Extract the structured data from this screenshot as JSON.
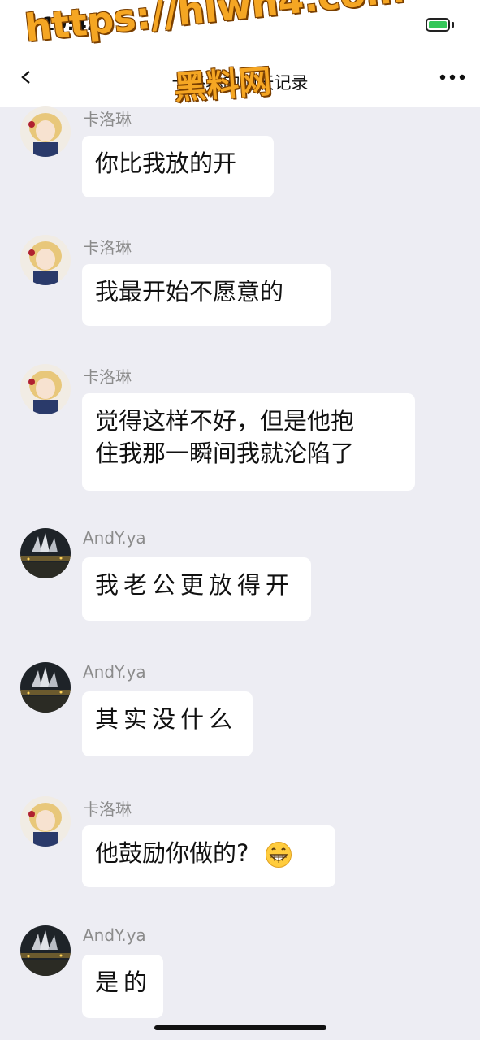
{
  "status_bar": {
    "time": "19:42",
    "battery_icon": "battery-charging-icon"
  },
  "nav_bar": {
    "title": "卡洛琳的聊天记录",
    "back_icon": "chevron-left-icon",
    "more_icon": "more-dots-icon"
  },
  "watermark": {
    "url": "https://hlwn4.com",
    "site": "黑料网"
  },
  "messages": [
    {
      "sender": "卡洛琳",
      "text": "你比我放的开"
    },
    {
      "sender": "卡洛琳",
      "text": "我最开始不愿意的"
    },
    {
      "sender": "卡洛琳",
      "line1": "觉得这样不好，但是他抱",
      "line2": "住我那一瞬间我就沦陷了"
    },
    {
      "sender": "AndY.ya",
      "text": "我老公更放得开"
    },
    {
      "sender": "AndY.ya",
      "text": "其实没什么"
    },
    {
      "sender": "卡洛琳",
      "text": "他鼓励你做的?",
      "emoji_icon": "grinning-emoji-icon"
    },
    {
      "sender": "AndY.ya",
      "text": "是的"
    }
  ],
  "colors": {
    "background": "#ededf3",
    "bubble": "#ffffff",
    "sender_text": "#8b8b8b",
    "watermark": "#f5a623"
  }
}
